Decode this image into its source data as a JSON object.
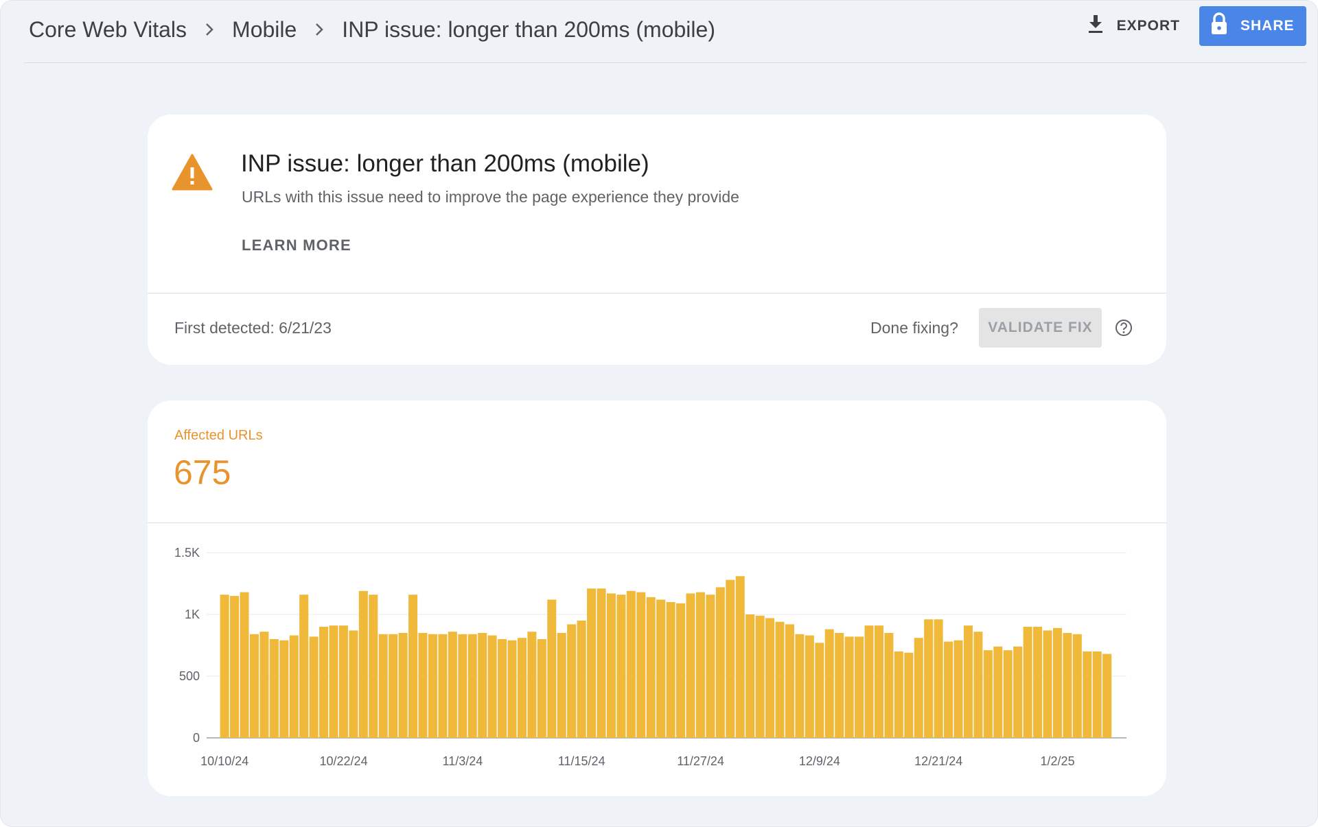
{
  "header": {
    "breadcrumb": [
      "Core Web Vitals",
      "Mobile",
      "INP issue: longer than 200ms (mobile)"
    ],
    "export_label": "EXPORT",
    "share_label": "SHARE"
  },
  "issue": {
    "title": "INP issue: longer than 200ms (mobile)",
    "description": "URLs with this issue need to improve the page experience they provide",
    "learn_more": "LEARN MORE",
    "first_detected": "First detected: 6/21/23",
    "done_fixing": "Done fixing?",
    "validate_label": "VALIDATE FIX"
  },
  "metric": {
    "label": "Affected URLs",
    "value": "675"
  },
  "colors": {
    "accent": "#e8932b",
    "bar": "#f0b93a",
    "share_button": "#4a86e8"
  },
  "icons": {
    "warning": "warning-icon",
    "export": "download-icon",
    "share": "lock-icon",
    "help": "help-icon"
  },
  "chart_data": {
    "type": "bar",
    "x_tick_labels": [
      "10/10/24",
      "10/22/24",
      "11/3/24",
      "11/15/24",
      "11/27/24",
      "12/9/24",
      "12/21/24",
      "1/2/25"
    ],
    "y_tick_labels": [
      "0",
      "500",
      "1K",
      "1.5K"
    ],
    "ylim": [
      0,
      1500
    ],
    "grid": true,
    "values": [
      1160,
      1150,
      1180,
      840,
      860,
      800,
      790,
      830,
      1160,
      820,
      900,
      910,
      910,
      870,
      1190,
      1160,
      840,
      840,
      850,
      1160,
      850,
      840,
      840,
      860,
      840,
      840,
      850,
      830,
      800,
      790,
      810,
      860,
      800,
      1120,
      850,
      920,
      950,
      1210,
      1210,
      1170,
      1160,
      1190,
      1180,
      1140,
      1120,
      1100,
      1090,
      1170,
      1180,
      1160,
      1220,
      1280,
      1310,
      1000,
      990,
      970,
      940,
      920,
      840,
      830,
      770,
      880,
      850,
      820,
      820,
      910,
      910,
      850,
      700,
      690,
      810,
      960,
      960,
      780,
      790,
      910,
      860,
      710,
      740,
      710,
      740,
      900,
      900,
      870,
      890,
      850,
      840,
      700,
      700,
      680
    ]
  }
}
